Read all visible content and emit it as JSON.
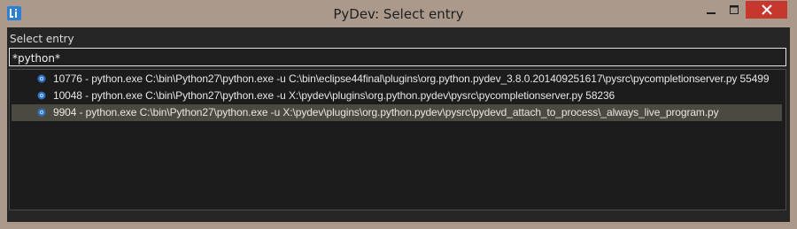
{
  "window": {
    "title": "PyDev: Select entry",
    "app_icon": "eclipse-app-icon",
    "controls": [
      "minimize-icon",
      "maximize-icon",
      "close-icon"
    ]
  },
  "dialog": {
    "label": "Select entry",
    "filter_value": "*python*"
  },
  "entries": [
    {
      "icon": "process-gear-icon",
      "text": "10776 - python.exe   C:\\bin\\Python27\\python.exe -u C:\\bin\\eclipse44final\\plugins\\org.python.pydev_3.8.0.201409251617\\pysrc\\pycompletionserver.py 55499",
      "selected": false
    },
    {
      "icon": "process-gear-icon",
      "text": "10048 - python.exe   C:\\bin\\Python27\\python.exe -u X:\\pydev\\plugins\\org.python.pydev\\pysrc\\pycompletionserver.py 58236",
      "selected": false
    },
    {
      "icon": "process-gear-icon",
      "text": "9904 - python.exe   C:\\bin\\Python27\\python.exe -u X:\\pydev\\plugins\\org.python.pydev\\pysrc\\pydevd_attach_to_process\\_always_live_program.py",
      "selected": true
    }
  ],
  "colors": {
    "frame": "#ab9a8b",
    "client_bg": "#262626",
    "selection": "#4b4a40",
    "close_button": "#c6382d"
  }
}
